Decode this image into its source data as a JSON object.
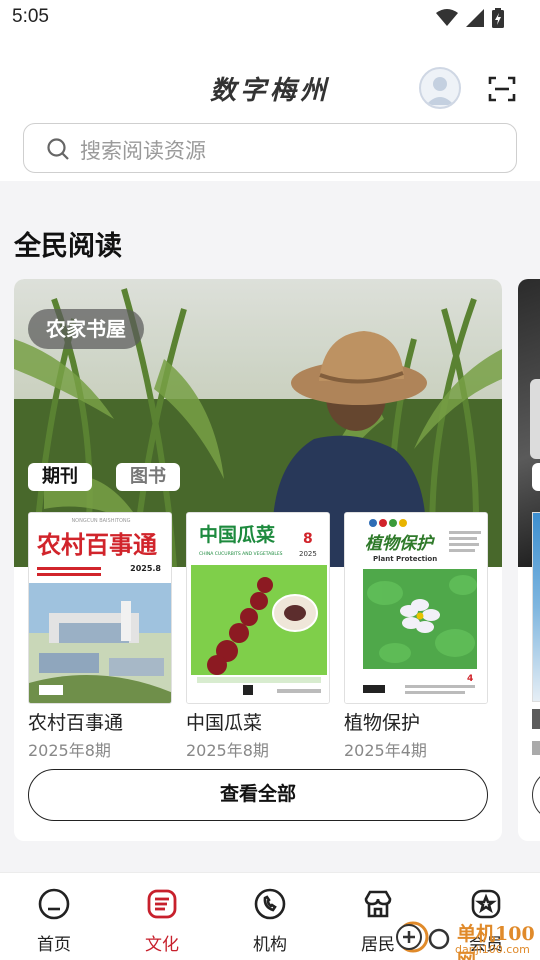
{
  "status_bar": {
    "time": "5:05"
  },
  "header": {
    "title": "数字梅州",
    "search_placeholder": "搜索阅读资源"
  },
  "section": {
    "title": "全民阅读",
    "card": {
      "tag": "农家书屋",
      "chips": [
        "期刊",
        "图书"
      ],
      "magazines": [
        {
          "name": "农村百事通",
          "issue": "2025年8期",
          "cover_title": "农村百事通",
          "cover_subtitle": "NONGCUN BAISHITONG",
          "cover_issue": "2025.8"
        },
        {
          "name": "中国瓜菜",
          "issue": "2025年8期",
          "cover_title": "中国瓜菜",
          "cover_subtitle": "CHINA CUCURBITS AND VEGETABLES",
          "cover_issue": "8",
          "cover_year": "2025"
        },
        {
          "name": "植物保护",
          "issue": "2025年4期",
          "cover_title": "植物保护",
          "cover_subtitle": "Plant Protection",
          "cover_issue": "4"
        }
      ],
      "view_all": "查看全部"
    }
  },
  "tabbar": {
    "items": [
      {
        "label": "首页",
        "icon": "home-icon",
        "active": false
      },
      {
        "label": "文化",
        "icon": "culture-icon",
        "active": true
      },
      {
        "label": "机构",
        "icon": "phone-icon",
        "active": false
      },
      {
        "label": "居民",
        "icon": "store-icon",
        "active": false
      },
      {
        "label": "会员",
        "icon": "badge-icon",
        "active": false
      }
    ],
    "active_color": "#c7202c"
  },
  "watermark": {
    "text": "单机100网",
    "url": "danji100.com"
  }
}
